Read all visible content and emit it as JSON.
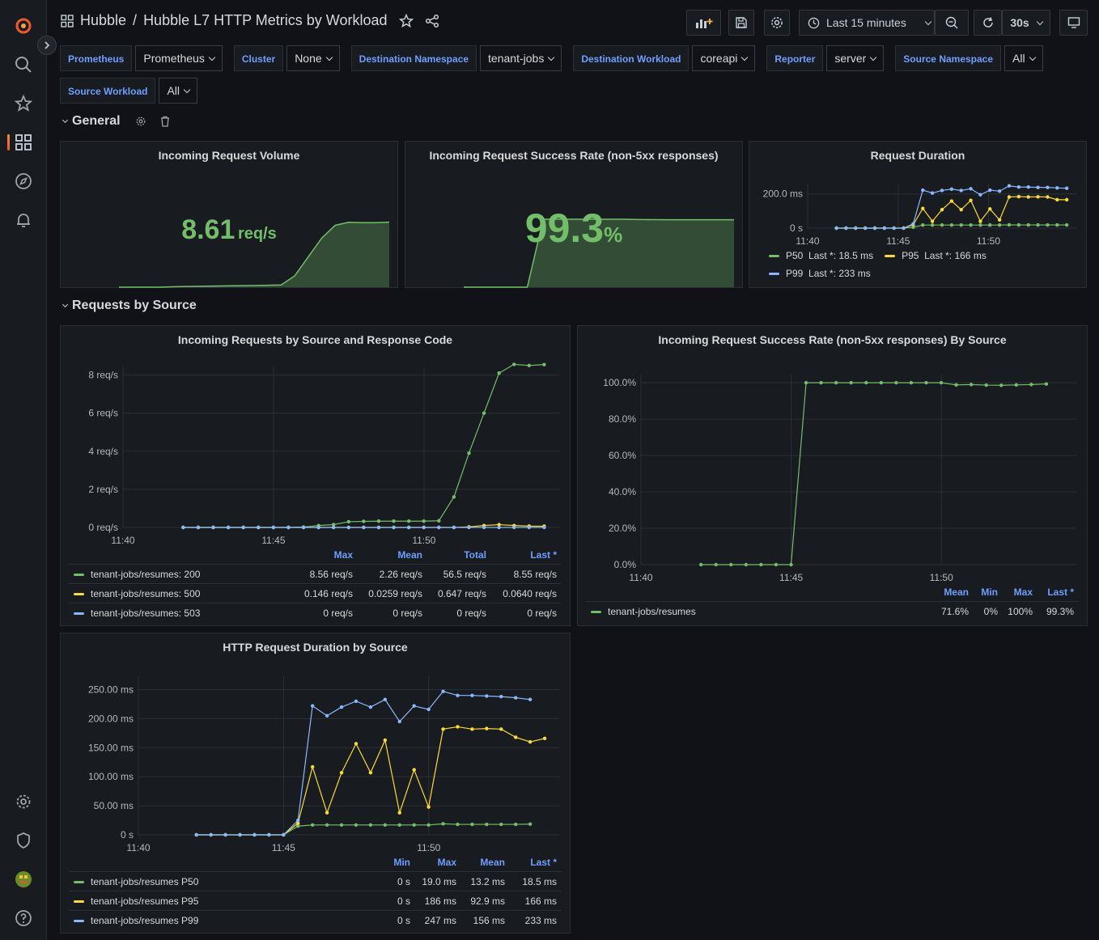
{
  "breadcrumb": {
    "root": "Hubble",
    "title": "Hubble L7 HTTP Metrics by Workload"
  },
  "toolbar": {
    "time_range": "Last 15 minutes",
    "refresh_interval": "30s"
  },
  "variables": [
    {
      "label": "Prometheus",
      "value": "Prometheus"
    },
    {
      "label": "Cluster",
      "value": "None"
    },
    {
      "label": "Destination Namespace",
      "value": "tenant-jobs"
    },
    {
      "label": "Destination Workload",
      "value": "coreapi"
    },
    {
      "label": "Reporter",
      "value": "server"
    },
    {
      "label": "Source Namespace",
      "value": "All"
    },
    {
      "label": "Source Workload",
      "value": "All"
    }
  ],
  "rows": {
    "general": "General",
    "requests_by_source": "Requests by Source"
  },
  "panels": {
    "volume": {
      "title": "Incoming Request Volume",
      "value": "8.61",
      "unit": "req/s"
    },
    "success": {
      "title": "Incoming Request Success Rate (non-5xx responses)",
      "value": "99.3",
      "unit": "%"
    },
    "duration": {
      "title": "Request Duration",
      "y_ticks": [
        "200.0 ms",
        "0 s"
      ],
      "x_ticks": [
        "11:40",
        "11:45",
        "11:50"
      ],
      "legend": [
        {
          "name": "P50",
          "last": "Last *: 18.5 ms",
          "color": "#73bf69"
        },
        {
          "name": "P95",
          "last": "Last *: 166 ms",
          "color": "#fade2a"
        },
        {
          "name": "P99",
          "last": "Last *: 233 ms",
          "color": "#8ab8ff"
        }
      ]
    },
    "by_source_code": {
      "title": "Incoming Requests by Source and Response Code",
      "y_ticks": [
        "8 req/s",
        "6 req/s",
        "4 req/s",
        "2 req/s",
        "0 req/s"
      ],
      "x_ticks": [
        "11:40",
        "11:45",
        "11:50"
      ],
      "columns": [
        "Max",
        "Mean",
        "Total",
        "Last *"
      ],
      "rows": [
        {
          "name": "tenant-jobs/resumes: 200",
          "color": "#73bf69",
          "max": "8.56 req/s",
          "mean": "2.26 req/s",
          "total": "56.5 req/s",
          "last": "8.55 req/s"
        },
        {
          "name": "tenant-jobs/resumes: 500",
          "color": "#fade2a",
          "max": "0.146 req/s",
          "mean": "0.0259 req/s",
          "total": "0.647 req/s",
          "last": "0.0640 req/s"
        },
        {
          "name": "tenant-jobs/resumes: 503",
          "color": "#8ab8ff",
          "max": "0 req/s",
          "mean": "0 req/s",
          "total": "0 req/s",
          "last": "0 req/s"
        }
      ]
    },
    "success_by_source": {
      "title": "Incoming Request Success Rate (non-5xx responses) By Source",
      "y_ticks": [
        "100.0%",
        "80.0%",
        "60.0%",
        "40.0%",
        "20.0%",
        "0.0%"
      ],
      "x_ticks": [
        "11:40",
        "11:45",
        "11:50"
      ],
      "columns": [
        "Mean",
        "Min",
        "Max",
        "Last *"
      ],
      "rows": [
        {
          "name": "tenant-jobs/resumes",
          "color": "#73bf69",
          "mean": "71.6%",
          "min": "0%",
          "max": "100%",
          "last": "99.3%"
        }
      ]
    },
    "duration_by_source": {
      "title": "HTTP Request Duration by Source",
      "y_ticks": [
        "250.00 ms",
        "200.00 ms",
        "150.00 ms",
        "100.00 ms",
        "50.00 ms",
        "0 s"
      ],
      "x_ticks": [
        "11:40",
        "11:45",
        "11:50"
      ],
      "columns": [
        "Min",
        "Max",
        "Mean",
        "Last *"
      ],
      "rows": [
        {
          "name": "tenant-jobs/resumes P50",
          "color": "#73bf69",
          "min": "0 s",
          "max": "19.0 ms",
          "mean": "13.2 ms",
          "last": "18.5 ms"
        },
        {
          "name": "tenant-jobs/resumes P95",
          "color": "#fade2a",
          "min": "0 s",
          "max": "186 ms",
          "mean": "92.9 ms",
          "last": "166 ms"
        },
        {
          "name": "tenant-jobs/resumes P99",
          "color": "#8ab8ff",
          "min": "0 s",
          "max": "247 ms",
          "mean": "156 ms",
          "last": "233 ms"
        }
      ]
    }
  },
  "chart_data": [
    {
      "type": "area",
      "title": "Incoming Request Volume",
      "series": [
        {
          "name": "",
          "values": [
            0,
            0,
            0,
            0,
            0.05,
            0.1,
            0.12,
            0.15,
            0.18,
            0.2,
            0.22,
            0.25,
            0.3,
            1.5,
            4.0,
            6.5,
            8.2,
            8.6,
            8.55,
            8.55,
            8.61
          ]
        }
      ]
    },
    {
      "type": "area",
      "title": "Incoming Request Success Rate (non-5xx responses)",
      "series": [
        {
          "name": "",
          "values": [
            0,
            0,
            0,
            0,
            0,
            100,
            100,
            100,
            100,
            100,
            100,
            99.5,
            99.4,
            99.3,
            99.3,
            99.3,
            99.3,
            99.3
          ]
        }
      ]
    },
    {
      "type": "line",
      "title": "Request Duration",
      "x": [
        "11:41",
        "11:41:30",
        "11:42",
        "11:42:30",
        "11:43",
        "11:43:30",
        "11:44",
        "11:44:30",
        "11:45",
        "11:45:30",
        "11:46",
        "11:46:30",
        "11:47",
        "11:47:30",
        "11:48",
        "11:48:30",
        "11:49",
        "11:49:30",
        "11:50",
        "11:50:30",
        "11:51",
        "11:51:30",
        "11:52",
        "11:52:30",
        "11:53"
      ],
      "series": [
        {
          "name": "P50",
          "values": [
            0,
            0,
            0,
            0,
            0,
            0,
            0,
            0,
            5,
            18,
            18,
            18,
            18,
            18,
            18,
            18,
            18,
            18,
            19,
            18.5,
            18.5,
            18.5,
            18.5,
            18.5,
            18.5
          ]
        },
        {
          "name": "P95",
          "values": [
            0,
            0,
            0,
            0,
            0,
            0,
            0,
            0,
            20,
            115,
            40,
            108,
            158,
            108,
            162,
            40,
            112,
            48,
            182,
            184,
            182,
            183,
            182,
            166,
            166
          ]
        },
        {
          "name": "P99",
          "values": [
            0,
            0,
            0,
            0,
            0,
            0,
            0,
            0,
            25,
            222,
            205,
            220,
            228,
            220,
            230,
            195,
            222,
            216,
            247,
            240,
            240,
            238,
            238,
            235,
            233
          ]
        }
      ],
      "ylim": [
        0,
        260
      ]
    },
    {
      "type": "line",
      "title": "Incoming Requests by Source and Response Code",
      "x": [
        "11:41",
        "11:41:30",
        "11:42",
        "11:42:30",
        "11:43",
        "11:43:30",
        "11:44",
        "11:44:30",
        "11:45",
        "11:45:30",
        "11:46",
        "11:46:30",
        "11:47",
        "11:47:30",
        "11:48",
        "11:48:30",
        "11:49",
        "11:49:30",
        "11:50",
        "11:50:30",
        "11:51",
        "11:51:30",
        "11:52",
        "11:52:30",
        "11:53"
      ],
      "series": [
        {
          "name": "tenant-jobs/resumes: 200",
          "values": [
            0,
            0,
            0,
            0,
            0,
            0,
            0,
            0,
            0.02,
            0.1,
            0.15,
            0.3,
            0.32,
            0.33,
            0.33,
            0.33,
            0.33,
            0.35,
            1.6,
            3.9,
            6.0,
            8.1,
            8.56,
            8.5,
            8.55
          ]
        },
        {
          "name": "tenant-jobs/resumes: 500",
          "values": [
            0,
            0,
            0,
            0,
            0,
            0,
            0,
            0,
            0,
            0,
            0,
            0,
            0,
            0,
            0,
            0,
            0,
            0,
            0,
            0.03,
            0.1,
            0.146,
            0.1,
            0.07,
            0.064
          ]
        },
        {
          "name": "tenant-jobs/resumes: 503",
          "values": [
            0,
            0,
            0,
            0,
            0,
            0,
            0,
            0,
            0,
            0,
            0,
            0,
            0,
            0,
            0,
            0,
            0,
            0,
            0,
            0,
            0,
            0,
            0,
            0,
            0
          ]
        }
      ],
      "ylim": [
        0,
        9
      ]
    },
    {
      "type": "line",
      "title": "Incoming Request Success Rate (non-5xx responses) By Source",
      "x": [
        "11:42",
        "11:42:30",
        "11:43",
        "11:43:30",
        "11:44",
        "11:44:30",
        "11:45",
        "11:45:30",
        "11:46",
        "11:46:30",
        "11:47",
        "11:47:30",
        "11:48",
        "11:48:30",
        "11:49",
        "11:49:30",
        "11:50",
        "11:50:30",
        "11:51",
        "11:51:30",
        "11:52",
        "11:52:30",
        "11:53"
      ],
      "series": [
        {
          "name": "tenant-jobs/resumes",
          "values": [
            0,
            0,
            0,
            0,
            0,
            0,
            0,
            100,
            100,
            100,
            100,
            100,
            100,
            100,
            100,
            100,
            100,
            98.8,
            99.0,
            98.7,
            98.6,
            98.8,
            99.0,
            99.3
          ]
        }
      ],
      "ylim": [
        0,
        100
      ]
    },
    {
      "type": "line",
      "title": "HTTP Request Duration by Source",
      "x": [
        "11:42",
        "11:42:30",
        "11:43",
        "11:43:30",
        "11:44",
        "11:44:30",
        "11:45",
        "11:45:30",
        "11:46",
        "11:46:30",
        "11:47",
        "11:47:30",
        "11:48",
        "11:48:30",
        "11:49",
        "11:49:30",
        "11:50",
        "11:50:30",
        "11:51",
        "11:51:30",
        "11:52",
        "11:52:30",
        "11:53"
      ],
      "series": [
        {
          "name": "tenant-jobs/resumes P50",
          "values": [
            0,
            0,
            0,
            0,
            0,
            0,
            0,
            15,
            17,
            17,
            17,
            17,
            17,
            17,
            17,
            17,
            17,
            19,
            18,
            18,
            18,
            18,
            18,
            18.5
          ]
        },
        {
          "name": "tenant-jobs/resumes P95",
          "values": [
            0,
            0,
            0,
            0,
            0,
            0,
            0,
            20,
            117,
            38,
            107,
            157,
            107,
            163,
            38,
            112,
            48,
            182,
            186,
            182,
            183,
            182,
            168,
            160,
            166
          ]
        },
        {
          "name": "tenant-jobs/resumes P99",
          "values": [
            0,
            0,
            0,
            0,
            0,
            0,
            0,
            25,
            222,
            205,
            220,
            230,
            220,
            233,
            195,
            222,
            216,
            247,
            240,
            240,
            239,
            238,
            236,
            233
          ]
        }
      ],
      "ylim": [
        0,
        260
      ]
    }
  ]
}
